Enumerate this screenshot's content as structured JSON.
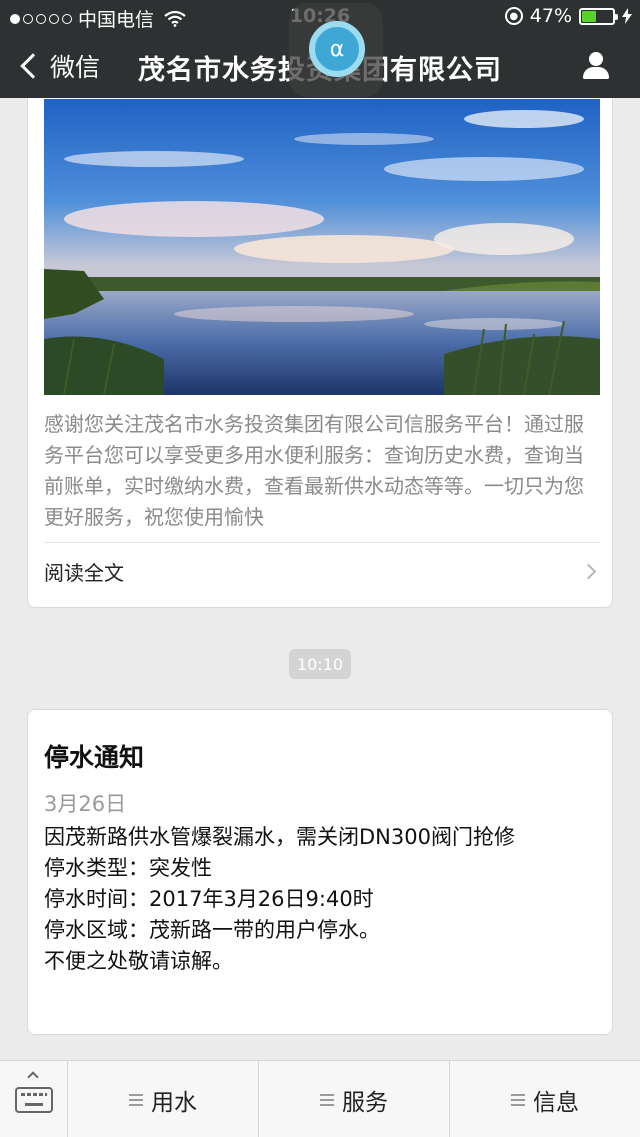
{
  "status_bar": {
    "carrier": "中国电信",
    "time": "10:26",
    "battery": "47%",
    "battery_level": 0.47
  },
  "nav": {
    "back_label": "微信",
    "title": "茂名市水务投资集团有限公司"
  },
  "assist_badge": {
    "glyph": "α"
  },
  "article": {
    "description": "感谢您关注茂名市水务投资集团有限公司信服务平台！通过服务平台您可以享受更多用水便利服务：查询历史水费，查询当前账单，实时缴纳水费，查看最新供水动态等等。一切只为您更好服务，祝您使用愉快",
    "read_more": "阅读全文"
  },
  "timestamp": "10:10",
  "notice": {
    "title": "停水通知",
    "date": "3月26日",
    "lines": [
      "因茂新路供水管爆裂漏水，需关闭DN300阀门抢修",
      "停水类型：突发性",
      "停水时间：2017年3月26日9:40时",
      "停水区域：茂新路一带的用户停水。",
      "不便之处敬请谅解。"
    ]
  },
  "bottom_menu": {
    "items": [
      {
        "label": "用水"
      },
      {
        "label": "服务"
      },
      {
        "label": "信息"
      }
    ]
  }
}
